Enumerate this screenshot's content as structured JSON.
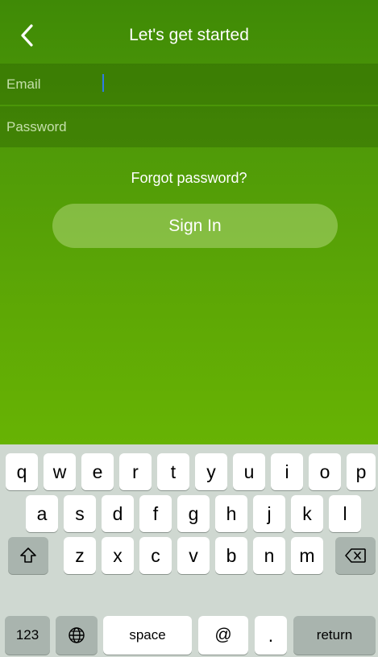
{
  "header": {
    "title": "Let's get started",
    "back_icon": "chevron-left-icon"
  },
  "form": {
    "email_placeholder": "Email",
    "password_placeholder": "Password",
    "forgot_label": "Forgot password?",
    "signin_label": "Sign In"
  },
  "keyboard": {
    "row1": [
      "q",
      "w",
      "e",
      "r",
      "t",
      "y",
      "u",
      "i",
      "o",
      "p"
    ],
    "row2": [
      "a",
      "s",
      "d",
      "f",
      "g",
      "h",
      "j",
      "k",
      "l"
    ],
    "row3": [
      "z",
      "x",
      "c",
      "v",
      "b",
      "n",
      "m"
    ],
    "shift_icon": "shift-icon",
    "backspace_icon": "backspace-icon",
    "numbers_label": "123",
    "globe_icon": "globe-icon",
    "space_label": "space",
    "at_label": "@",
    "dot_label": ".",
    "return_label": "return"
  },
  "colors": {
    "gradient_top": "#3f8a06",
    "gradient_bottom": "#67b304",
    "keyboard_bg": "#cfd8d1",
    "cursor": "#2f7be6"
  }
}
